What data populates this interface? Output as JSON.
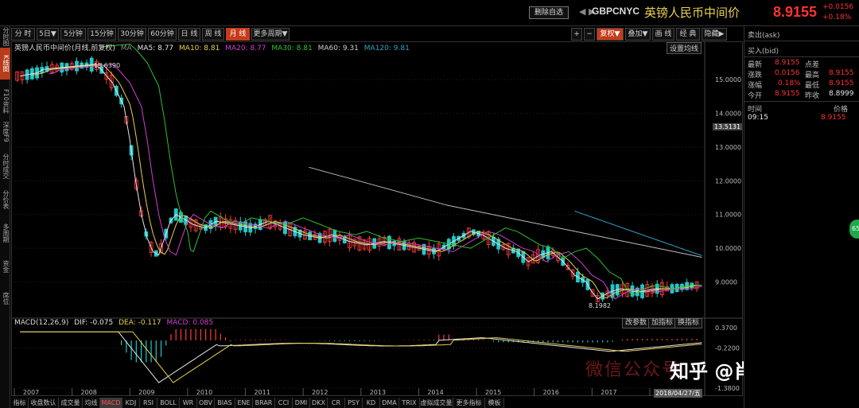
{
  "header": {
    "delete_label": "删除自选",
    "nav": "◀  ▶",
    "symbol": "GBPCNYC",
    "name": "英镑人民币中间价",
    "price": "8.9155",
    "change": "+0.0156",
    "change_pct": "+0.18%"
  },
  "left_tabs": [
    "分时图",
    "K线图",
    "F10资料",
    "深度F9",
    "分时成交",
    "分价表",
    "多周期",
    "资金",
    "席位"
  ],
  "toolbar": {
    "periods": [
      "分 时",
      "5日▼",
      "5分钟",
      "15分钟",
      "30分钟",
      "60分钟",
      "日 线",
      "周 线",
      "月 线",
      "更多周期▼"
    ],
    "active_period": "月 线",
    "right": [
      "+",
      "−",
      "复权▼",
      "叠加▼",
      "画 线",
      "经 典",
      "隐藏▶"
    ]
  },
  "main_legend": {
    "title": "英镑人民币中间价(月线,前复权)",
    "ma_label": "MA",
    "ma5": "MA5: 8.77",
    "ma10": "MA10: 8.81",
    "ma20": "MA20: 8.77",
    "ma30": "MA30: 8.81",
    "ma60": "MA60: 9.31",
    "ma120": "MA120: 9.81",
    "set_ma": "设置均线"
  },
  "macd_legend": {
    "name": "MACD(12,26,9)",
    "dif": "DIF: -0.075",
    "dea": "DEA: -0.117",
    "macd": "MACD: 0.085",
    "buttons": [
      "改参数",
      "加指标",
      "换指标"
    ]
  },
  "chart_labels": {
    "high_mark": "15.6390",
    "low_mark": "8.1982",
    "current_tag": "13.5131",
    "date_tag": "2018/04/27/五"
  },
  "chart_data": {
    "type": "line",
    "x": [
      "2006.6",
      "2006.9",
      "2007.0",
      "2007.3",
      "2007.6",
      "2007.9",
      "2008.0",
      "2008.2",
      "2008.4",
      "2008.5",
      "2008.6",
      "2008.7",
      "2008.8",
      "2008.9",
      "2009.0",
      "2009.1",
      "2009.2",
      "2009.3",
      "2009.4",
      "2009.5",
      "2009.6",
      "2009.8",
      "2010.0",
      "2010.3",
      "2010.6",
      "2010.9",
      "2011.2",
      "2011.5",
      "2011.8",
      "2012.0",
      "2012.3",
      "2012.6",
      "2012.9",
      "2013.2",
      "2013.5",
      "2013.8",
      "2014.0",
      "2014.2",
      "2014.4",
      "2014.6",
      "2014.8",
      "2015.0",
      "2015.2",
      "2015.4",
      "2015.6",
      "2015.8",
      "2016.0",
      "2016.2",
      "2016.4",
      "2016.5",
      "2016.6",
      "2016.7",
      "2016.8",
      "2017.0",
      "2017.3",
      "2017.6",
      "2017.9",
      "2018.2",
      "2018.35"
    ],
    "series": [
      {
        "name": "MA5",
        "color": "#e6e6e6",
        "values": [
          15.1,
          15.2,
          15.3,
          15.35,
          15.4,
          15.45,
          15.3,
          14.9,
          14.2,
          13.2,
          12.0,
          11.0,
          10.3,
          9.9,
          9.8,
          10.3,
          10.8,
          11.0,
          10.9,
          10.8,
          10.7,
          10.6,
          10.8,
          10.7,
          10.6,
          10.8,
          10.6,
          10.4,
          10.3,
          10.4,
          10.2,
          10.1,
          10.2,
          10.1,
          10.0,
          9.9,
          10.1,
          10.3,
          10.5,
          10.4,
          10.2,
          10.0,
          9.9,
          9.6,
          9.8,
          9.9,
          9.6,
          9.2,
          9.0,
          8.7,
          8.5,
          8.6,
          8.7,
          8.8,
          8.7,
          8.8,
          8.8,
          8.9,
          8.9
        ]
      }
    ],
    "y_ticks": [
      "15.0000",
      "14.0000",
      "13.0000",
      "12.0000",
      "11.0000",
      "10.0000",
      "9.0000"
    ],
    "ylim": [
      8.0,
      15.8
    ],
    "x_ticks": [
      "2007",
      "2008",
      "2009",
      "2010",
      "2011",
      "2012",
      "2013",
      "2014",
      "2015",
      "2016",
      "2017",
      "2018"
    ],
    "macd_ticks": [
      "0.3700",
      "-0.2200",
      "-1.3800"
    ]
  },
  "right_panel": {
    "sell": "卖出(ask)",
    "buy": "买入(bid)",
    "rows": [
      {
        "l1": "最新",
        "v1": "8.9155",
        "l2": "点差",
        "v2": ""
      },
      {
        "l1": "涨跌",
        "v1": "0.0156",
        "l2": "最高",
        "v2": "8.9155"
      },
      {
        "l1": "涨幅",
        "v1": "0.18%",
        "l2": "最低",
        "v2": "8.9155"
      },
      {
        "l1": "今开",
        "v1": "8.9155",
        "l2": "昨收",
        "v2": "8.8999"
      }
    ],
    "time_header": "时间",
    "price_header": "价格",
    "tick_time": "09:15",
    "tick_price": "8.9155",
    "badge": "65"
  },
  "bottom_tabs": [
    "指标",
    "收盘数认",
    "成交量",
    "均线",
    "MACD",
    "KDJ",
    "RSI",
    "BOLL",
    "WR",
    "OBV",
    "BIAS",
    "ENE",
    "BRAR",
    "CCI",
    "DMI",
    "DKX",
    "CR",
    "PSY",
    "KD",
    "DMA",
    "TRIX",
    "虚拟成交量",
    "更多指标",
    "模板"
  ],
  "watermark": {
    "text": "微信公众号",
    "brand": "知乎 @肖东敏"
  }
}
